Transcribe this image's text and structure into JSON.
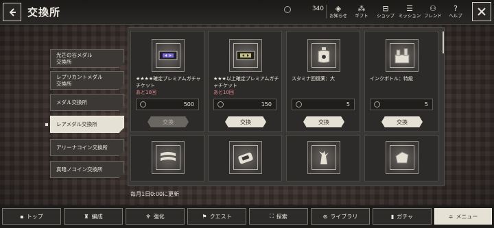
{
  "header": {
    "title": "交換所",
    "currency_value": "340",
    "nav": [
      {
        "label": "お知らせ",
        "icon": "◈"
      },
      {
        "label": "ギフト",
        "icon": "⁂"
      },
      {
        "label": "ショップ",
        "icon": "⊟"
      },
      {
        "label": "ミッション",
        "icon": "☰"
      },
      {
        "label": "フレンド",
        "icon": "⚇"
      },
      {
        "label": "ヘルプ",
        "icon": "?"
      }
    ]
  },
  "sidebar": {
    "items": [
      {
        "label": "光芒の谷メダル\n交換所"
      },
      {
        "label": "レプリカントメダル\n交換所"
      },
      {
        "label": "メダル交換所"
      },
      {
        "label": "レアメダル交換所"
      },
      {
        "label": "アリーナコイン交換所"
      },
      {
        "label": "真暗ノコイン交換所"
      }
    ]
  },
  "items": [
    {
      "name": "★★★★確定プレミアムガチャチケット",
      "limit": "あと10回",
      "price": "500",
      "button": "交換",
      "icon": "ticket-icon"
    },
    {
      "name": "★★★以上確定プレミアムガチャチケット",
      "limit": "あと10回",
      "price": "150",
      "button": "交換",
      "icon": "ticket-icon"
    },
    {
      "name": "スタミナ回復薬：大",
      "limit": "",
      "price": "5",
      "button": "交換",
      "icon": "potion-icon"
    },
    {
      "name": "インクボトル：特級",
      "limit": "",
      "price": "5",
      "button": "交換",
      "icon": "ink-bottle-icon"
    },
    {
      "name": "",
      "icon": "material-icon"
    },
    {
      "name": "",
      "icon": "material-icon"
    },
    {
      "name": "",
      "icon": "material-icon"
    },
    {
      "name": "",
      "icon": "material-icon"
    }
  ],
  "refresh_text": "毎月1日0:00に更新",
  "footer": {
    "top": "トップ",
    "edit": "編成",
    "enhance": "強化",
    "quest": "クエスト",
    "explore": "探索",
    "library": "ライブラリ",
    "gacha": "ガチャ",
    "menu": "メニュー"
  }
}
